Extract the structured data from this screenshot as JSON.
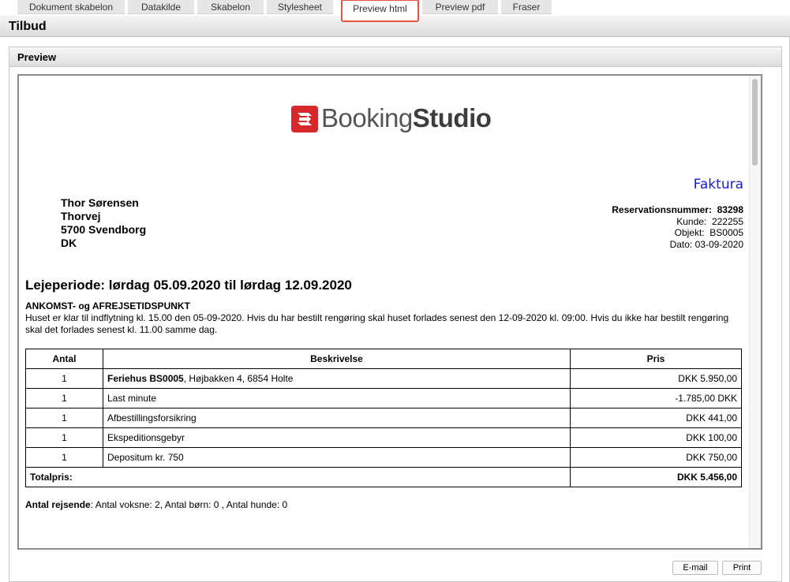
{
  "tabs": [
    {
      "label": "Dokument skabelon"
    },
    {
      "label": "Datakilde"
    },
    {
      "label": "Skabelon"
    },
    {
      "label": "Stylesheet"
    },
    {
      "label": "Preview html"
    },
    {
      "label": "Preview pdf"
    },
    {
      "label": "Fraser"
    }
  ],
  "active_tab": "Preview html",
  "page_title": "Tilbud",
  "panel_title": "Preview",
  "doc": {
    "logo": {
      "light": "Booking",
      "bold": "Studio"
    },
    "doc_type": "Faktura",
    "customer_lines": [
      "Thor Sørensen",
      "Thorvej",
      "5700 Svendborg",
      "DK"
    ],
    "meta": {
      "res_label": "Reservationsnummer:",
      "res_value": "83298",
      "kunde_label": "Kunde:",
      "kunde_value": "222255",
      "objekt_label": "Objekt:",
      "objekt_value": "BS0005",
      "dato_label": "Dato:",
      "dato_value": "03-09-2020"
    },
    "period": "Lejeperiode: lørdag 05.09.2020 til lørdag 12.09.2020",
    "arrival_heading": "ANKOMST- og AFREJSETIDSPUNKT",
    "arrival_text": "Huset er klar til indflytning kl. 15.00 den 05-09-2020. Hvis du har bestilt rengøring skal huset forlades senest den 12-09-2020 kl. 09:00. Hvis du ikke har bestilt rengøring skal det forlades senest kl. 11.00 samme dag.",
    "table": {
      "headers": {
        "antal": "Antal",
        "beskrivelse": "Beskrivelse",
        "pris": "Pris"
      },
      "rows": [
        {
          "antal": "1",
          "bold": "Feriehus BS0005",
          "text": ", Højbakken 4, 6854 Holte",
          "pris": "DKK 5.950,00"
        },
        {
          "antal": "1",
          "bold": "",
          "text": "Last minute",
          "pris": "-1.785,00 DKK"
        },
        {
          "antal": "1",
          "bold": "",
          "text": "Afbestillingsforsikring",
          "pris": "DKK 441,00"
        },
        {
          "antal": "1",
          "bold": "",
          "text": "Ekspeditionsgebyr",
          "pris": "DKK 100,00"
        },
        {
          "antal": "1",
          "bold": "",
          "text": "Depositum kr. 750",
          "pris": "DKK 750,00"
        }
      ],
      "total_label": "Totalpris:",
      "total_value": "DKK 5.456,00"
    },
    "travellers_label": "Antal rejsende",
    "travellers_text": ":  Antal voksne: 2,  Antal børn: 0 , Antal hunde: 0"
  },
  "buttons": {
    "email": "E-mail",
    "print": "Print"
  },
  "colors": {
    "active_tab_border": "#e8553f",
    "doc_type": "#1a1ad8",
    "logo_red": "#d7272b"
  }
}
